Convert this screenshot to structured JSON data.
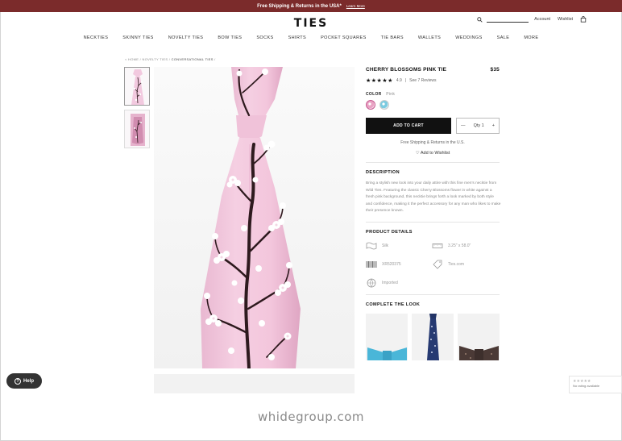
{
  "promo": {
    "text": "Free Shipping & Returns in the USA*",
    "link": "Learn More"
  },
  "brand": {
    "logo": "TIES"
  },
  "header": {
    "account": "Account",
    "wishlist": "Wishlist"
  },
  "nav": [
    "NECKTIES",
    "SKINNY TIES",
    "NOVELTY TIES",
    "BOW TIES",
    "SOCKS",
    "SHIRTS",
    "POCKET SQUARES",
    "TIE BARS",
    "WALLETS",
    "WEDDINGS",
    "SALE",
    "MORE"
  ],
  "breadcrumb": {
    "home": "< HOME",
    "sep1": "/",
    "novelty": "NOVELTY TIES",
    "sep2": "/",
    "current": "CONVERSATIONAL TIES",
    "sep3": "/"
  },
  "product": {
    "title": "CHERRY BLOSSOMS PINK TIE",
    "price": "$35",
    "stars": "★★★★★",
    "rating": "4.9",
    "rating_sep": "|",
    "reviews": "See 7 Reviews",
    "color_label": "COLOR",
    "color_value": "Pink",
    "add_to_cart": "ADD TO CART",
    "qty_minus": "—",
    "qty_label": "Qty 1",
    "qty_plus": "+",
    "shipping": "Free Shipping & Returns in the U.S.",
    "wishlist": "Add to Wishlist",
    "description_title": "DESCRIPTION",
    "description": "Bring a stylish new look into your daily attire with this fine men's necktie from Wild Ties. Featuring the classic Cherry Blossoms flower in white against a fresh pink background, this necktie brings forth a look marked by both style and confidence, making it the perfect accessory for any man who likes to make their presence known.",
    "details_title": "PRODUCT DETAILS",
    "details": {
      "material": "Silk",
      "size": "3.25\" x 58.0\"",
      "sku": "XR520375",
      "site": "Ties.com",
      "origin": "Imported"
    },
    "look_title": "COMPLETE THE LOOK"
  },
  "help": {
    "label": "Help"
  },
  "rating_widget": {
    "stars": "★★★★★",
    "text": "No rating available"
  },
  "watermark": "whidegroup.com",
  "colors": {
    "promo": "#7b2b2b",
    "tie_pink": "#f2c9df",
    "branch": "#2e1a1e",
    "blossom": "#ffffff",
    "cart": "#111111"
  }
}
